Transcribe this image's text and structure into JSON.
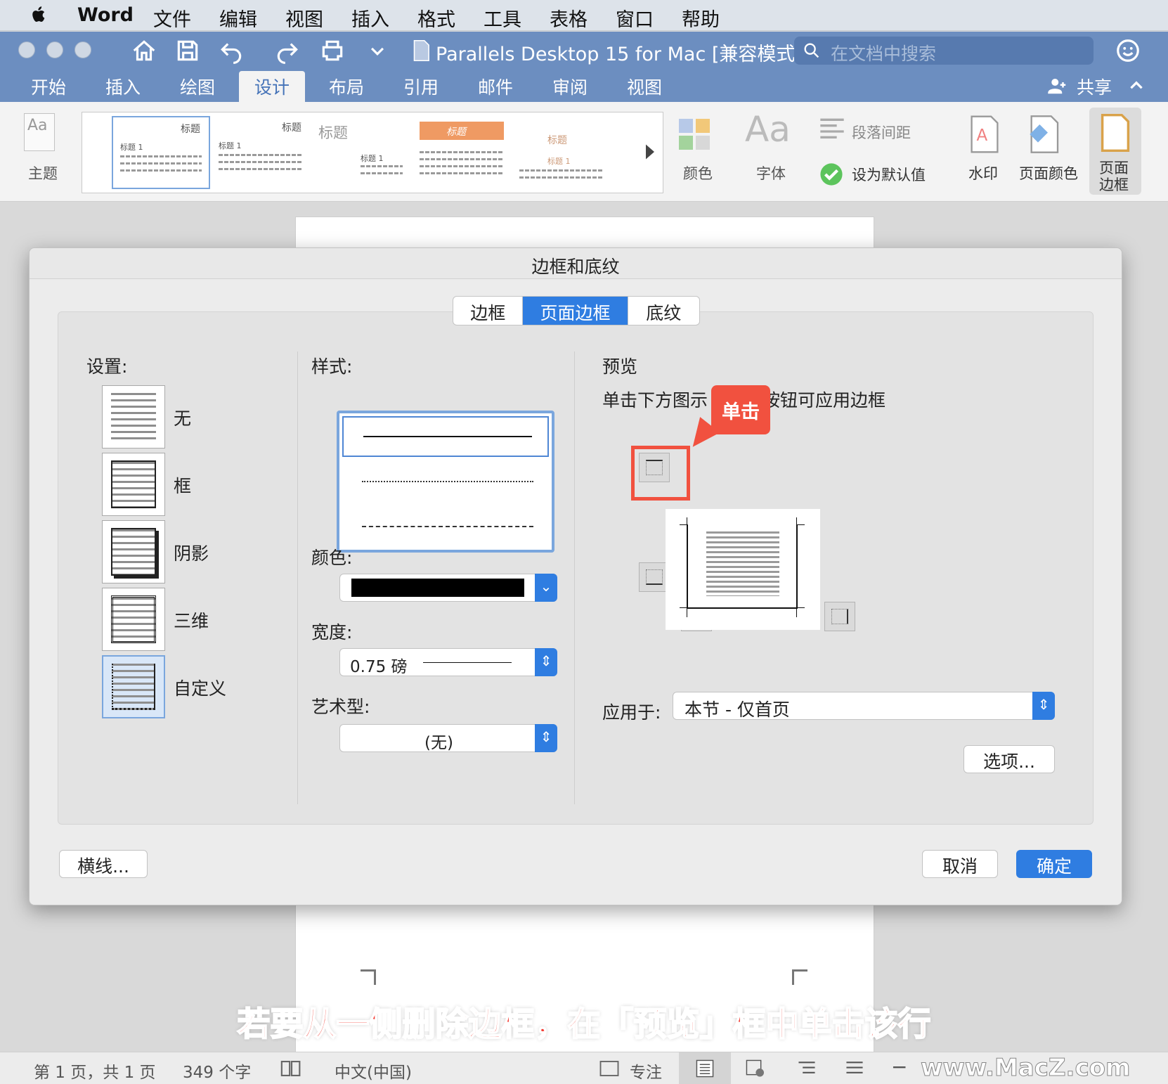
{
  "menubar": {
    "app": "Word",
    "items": [
      "文件",
      "编辑",
      "视图",
      "插入",
      "格式",
      "工具",
      "表格",
      "窗口",
      "帮助"
    ]
  },
  "titlebar": {
    "doc_title": "Parallels Desktop 15 for Mac [兼容模式]",
    "search_placeholder": "在文档中搜索"
  },
  "ribbon_tabs": [
    "开始",
    "插入",
    "绘图",
    "设计",
    "布局",
    "引用",
    "邮件",
    "审阅",
    "视图"
  ],
  "active_tab": "设计",
  "share_label": "共享",
  "ribbon": {
    "theme_label": "主题",
    "gallery_heading": "标题",
    "gallery_sub": "标题 1",
    "colors_label": "颜色",
    "fonts_label": "字体",
    "fonts_icon_text": "Aa",
    "theme_icon_text": "Aa",
    "paragraph_spacing": "段落间距",
    "set_default": "设为默认值",
    "watermark": "水印",
    "page_color": "页面颜色",
    "page_border_line1": "页面",
    "page_border_line2": "边框"
  },
  "dialog": {
    "title": "边框和底纹",
    "tabs": [
      "边框",
      "页面边框",
      "底纹"
    ],
    "active_tab": "页面边框",
    "settings_label": "设置:",
    "settings": [
      "无",
      "框",
      "阴影",
      "三维",
      "自定义"
    ],
    "selected_setting": "自定义",
    "style_label": "样式:",
    "color_label": "颜色:",
    "color_value": "#000000",
    "width_label": "宽度:",
    "width_value": "0.75 磅",
    "art_label": "艺术型:",
    "art_value": "(无)",
    "preview_label": "预览",
    "preview_hint_left": "单击下方图示",
    "preview_hint_right": "按钮可应用边框",
    "apply_to_label": "应用于:",
    "apply_to_value": "本节 - 仅首页",
    "options_button": "选项...",
    "horizontal_line_button": "横线...",
    "cancel_button": "取消",
    "ok_button": "确定"
  },
  "callout": "单击",
  "caption": "若要从一侧删除边框，在「预览」框中单击该行",
  "statusbar": {
    "page": "第 1 页，共 1 页",
    "words": "349 个字",
    "language": "中文(中国)",
    "focus": "专注",
    "watermark": "www.MacZ.com"
  },
  "colors": {
    "accent": "#2f7de1",
    "titlebar": "#6c8ec0",
    "callout": "#f1513f"
  }
}
